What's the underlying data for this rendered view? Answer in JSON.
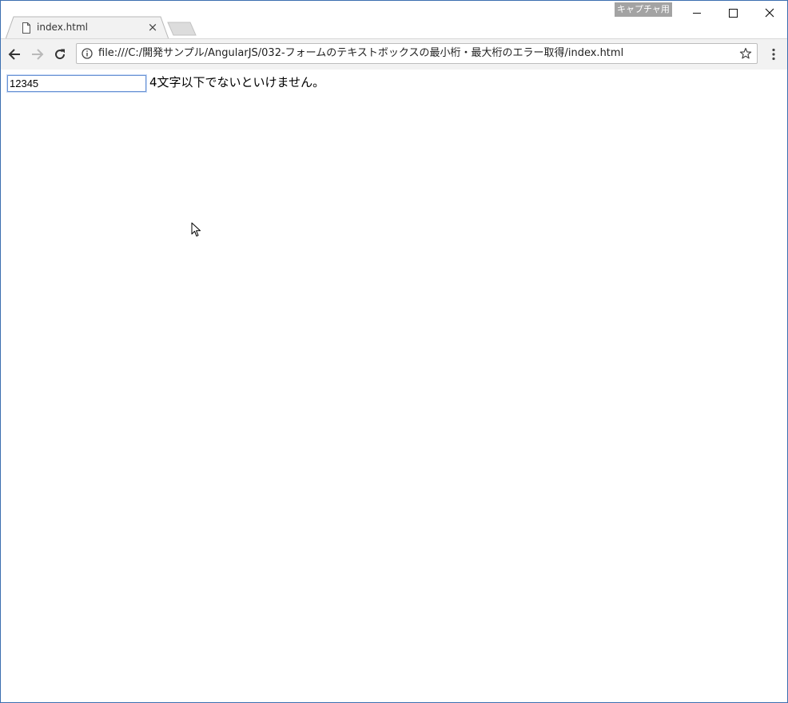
{
  "window": {
    "capture_badge": "キャプチャ用"
  },
  "tab": {
    "title": "index.html",
    "close_glyph": "×"
  },
  "toolbar": {
    "url": "file:///C:/開発サンプル/AngularJS/032-フォームのテキストボックスの最小桁・最大桁のエラー取得/index.html"
  },
  "page": {
    "input_value": "12345",
    "error_message": "4文字以下でないといけません。"
  },
  "colors": {
    "window_border": "#3c6fb0",
    "input_focus_border": "#6a93d4",
    "toolbar_bg": "#f2f2f2"
  }
}
